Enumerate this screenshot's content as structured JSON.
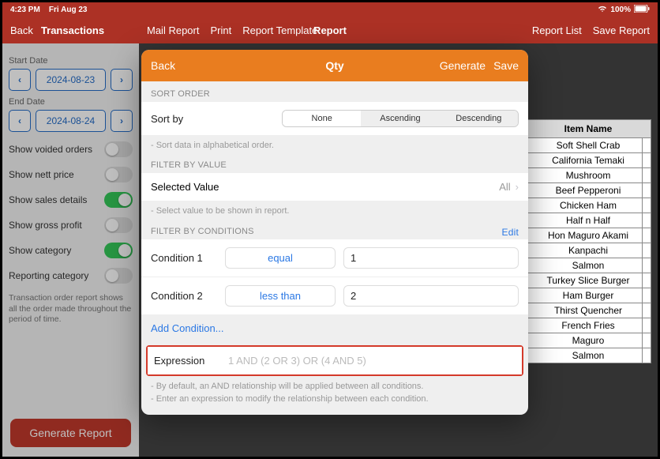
{
  "status": {
    "time": "4:23 PM",
    "date": "Fri Aug 23",
    "battery": "100%"
  },
  "topnav": {
    "back": "Back",
    "transactions": "Transactions",
    "mail_report": "Mail Report",
    "print": "Print",
    "report_template": "Report Template",
    "title": "Report",
    "report_list": "Report List",
    "save_report": "Save Report"
  },
  "sidebar": {
    "start_label": "Start Date",
    "start_date": "2024-08-23",
    "end_label": "End Date",
    "end_date": "2024-08-24",
    "toggles": [
      {
        "label": "Show voided orders",
        "on": false
      },
      {
        "label": "Show nett price",
        "on": false
      },
      {
        "label": "Show sales details",
        "on": true
      },
      {
        "label": "Show gross profit",
        "on": false
      },
      {
        "label": "Show category",
        "on": true
      },
      {
        "label": "Reporting category",
        "on": false
      }
    ],
    "note": "Transaction order report shows all the order made throughout the period of time.",
    "generate": "Generate Report"
  },
  "table": {
    "header": "Item Name",
    "rows": [
      "Soft Shell Crab",
      "California Temaki",
      "Mushroom",
      "Beef Pepperoni",
      "Chicken Ham",
      "Half n Half",
      "Hon Maguro Akami",
      "Kanpachi",
      "Salmon",
      "Turkey Slice Burger",
      "Ham Burger",
      "Thirst Quencher",
      "French Fries",
      "Maguro",
      "Salmon"
    ]
  },
  "modal": {
    "back": "Back",
    "title": "Qty",
    "generate": "Generate",
    "save": "Save",
    "sort_order_label": "SORT ORDER",
    "sort_by": "Sort by",
    "seg": [
      "None",
      "Ascending",
      "Descending"
    ],
    "sort_note": "- Sort data in alphabetical order.",
    "filter_value_label": "FILTER BY VALUE",
    "selected_value": "Selected Value",
    "selected_all": "All",
    "selected_note": "- Select value to be shown in report.",
    "filter_cond_label": "FILTER BY CONDITIONS",
    "edit": "Edit",
    "cond1_label": "Condition 1",
    "cond1_op": "equal",
    "cond1_val": "1",
    "cond2_label": "Condition 2",
    "cond2_op": "less than",
    "cond2_val": "2",
    "add_condition": "Add Condition...",
    "expression_label": "Expression",
    "expression_placeholder": "1 AND (2 OR 3) OR (4 AND 5)",
    "expr_note1": "- By default, an AND relationship will be applied between all conditions.",
    "expr_note2": "- Enter an expression to modify the relationship between each condition."
  }
}
